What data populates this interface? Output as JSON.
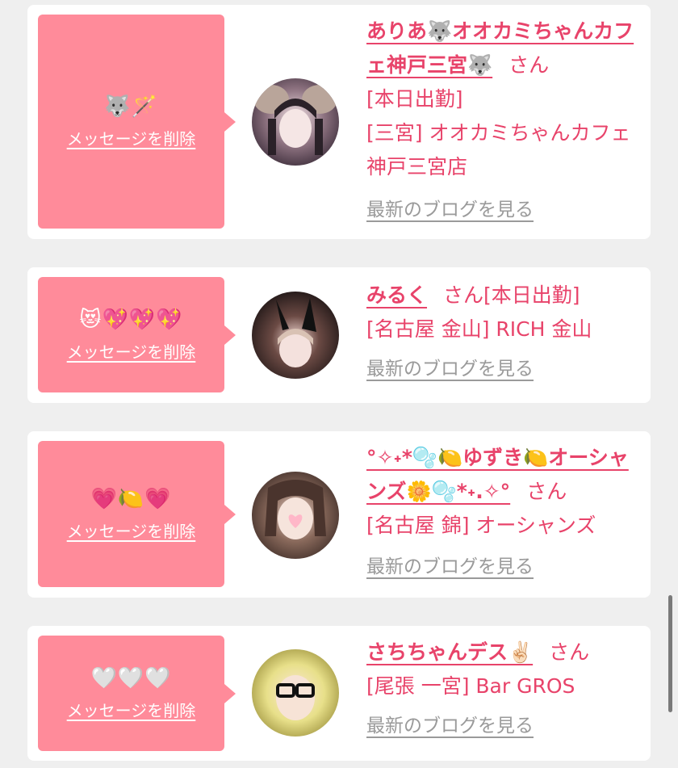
{
  "favorites": [
    {
      "bubble_emoji": "🐺🪄",
      "delete_label": "メッセージを削除",
      "name": "ありあ🐺オオカミちゃんカフェ神戸三宮🐺",
      "suffix": "さん",
      "status": "[本日出勤]",
      "shop": "[三宮] オオカミちゃんカフェ神戸三宮店",
      "blog_label": "最新のブログを見る"
    },
    {
      "bubble_emoji": "😻💖💖💖",
      "delete_label": "メッセージを削除",
      "name": "みるく",
      "suffix": "さん",
      "status": "[本日出勤]",
      "shop": "[名古屋 金山] RICH 金山",
      "blog_label": "最新のブログを見る"
    },
    {
      "bubble_emoji": "💗🍋💗",
      "delete_label": "メッセージを削除",
      "name": "°✧˖*🫧🍋ゆずき🍋オーシャンズ🌼🫧*˖.✧°",
      "suffix": "さん",
      "status": "",
      "shop": "[名古屋 錦] オーシャンズ",
      "blog_label": "最新のブログを見る"
    },
    {
      "bubble_emoji": "🤍🤍🤍",
      "delete_label": "メッセージを削除",
      "name": "さちちゃんデス✌🏻",
      "suffix": "さん",
      "status": "",
      "shop": "[尾張 一宮] Bar GROS",
      "blog_label": "最新のブログを見る"
    }
  ],
  "colors": {
    "accent_pink": "#e8436a",
    "bubble_pink": "#ff8b9a",
    "page_bg": "#efefef",
    "link_gray": "#9a9a9a"
  }
}
